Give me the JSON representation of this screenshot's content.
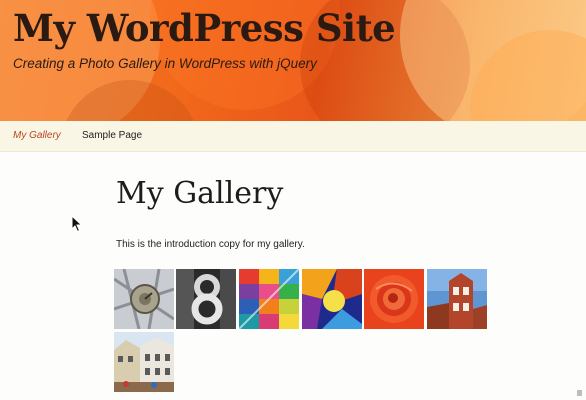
{
  "site": {
    "title": "My WordPress Site",
    "description": "Creating a Photo Gallery in WordPress with jQuery"
  },
  "nav": {
    "items": [
      {
        "label": "My Gallery",
        "current": true
      },
      {
        "label": "Sample Page",
        "current": false
      }
    ]
  },
  "page": {
    "title": "My Gallery",
    "intro": "This is the introduction copy for my gallery."
  },
  "gallery": {
    "images": [
      {
        "subject": "clock-sculpture"
      },
      {
        "subject": "number-eight"
      },
      {
        "subject": "color-grid"
      },
      {
        "subject": "abstract-art"
      },
      {
        "subject": "red-rose"
      },
      {
        "subject": "brick-tower"
      },
      {
        "subject": "street-buildings"
      }
    ]
  },
  "colors": {
    "header_accent": "#f26a1b",
    "nav_active": "#b8461f",
    "nav_background": "#f9f6e6"
  }
}
